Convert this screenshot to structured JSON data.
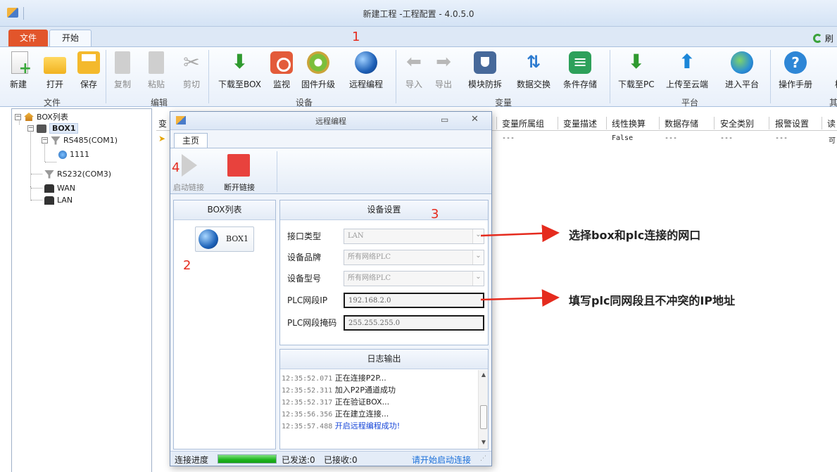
{
  "window": {
    "title": "新建工程 -工程配置 - 4.0.5.0"
  },
  "tabs": {
    "file": "文件",
    "start": "开始",
    "refresh": "刷"
  },
  "ribbon": {
    "file_group": {
      "label": "文件",
      "new": "新建",
      "open": "打开",
      "save": "保存"
    },
    "edit_group": {
      "label": "编辑",
      "copy": "复制",
      "paste": "粘贴",
      "cut": "剪切"
    },
    "device_group": {
      "label": "设备",
      "download_box": "下载至BOX",
      "monitor": "监视",
      "firmware": "固件升级",
      "remote": "远程编程"
    },
    "variable_group": {
      "label": "变量",
      "import": "导入",
      "export": "导出",
      "module_guard": "模块防拆",
      "data_exchange": "数据交换",
      "condition_store": "条件存储"
    },
    "platform_group": {
      "label": "平台",
      "download_pc": "下载至PC",
      "upload_cloud": "上传至云端",
      "enter_platform": "进入平台"
    },
    "help": {
      "manual": "操作手册",
      "truncated": "检",
      "group_truncated": "其"
    }
  },
  "tree": {
    "root": "BOX列表",
    "box": "BOX1",
    "rs485": "RS485(COM1)",
    "device": "1111",
    "rs232": "RS232(COM3)",
    "wan": "WAN",
    "lan": "LAN"
  },
  "grid": {
    "first_col": "变",
    "columns": [
      "变量所属组",
      "变量描述",
      "线性换算",
      "数据存储",
      "安全类别",
      "报警设置",
      "读"
    ],
    "row": [
      "---",
      "",
      "False",
      "---",
      "---",
      "---",
      "可"
    ]
  },
  "dialog": {
    "title": "远程编程",
    "tab": "主页",
    "start_link": "启动链接",
    "stop_link": "断开链接",
    "boxlist_title": "BOX列表",
    "box_item": "BOX1",
    "settings_title": "设备设置",
    "fields": {
      "interface_label": "接口类型",
      "interface_value": "LAN",
      "brand_label": "设备品牌",
      "brand_value": "所有网络PLC",
      "model_label": "设备型号",
      "model_value": "所有网络PLC",
      "ip_label": "PLC网段IP",
      "ip_value": "192.168.2.0",
      "mask_label": "PLC网段掩码",
      "mask_value": "255.255.255.0"
    },
    "log_title": "日志输出",
    "log": [
      {
        "time": "12:35:52.071",
        "msg": "正在连接P2P..."
      },
      {
        "time": "12:35:52.311",
        "msg": "加入P2P通道成功"
      },
      {
        "time": "12:35:52.317",
        "msg": "正在验证BOX..."
      },
      {
        "time": "12:35:56.356",
        "msg": "正在建立连接..."
      },
      {
        "time": "12:35:57.488",
        "msg": "开启远程编程成功!"
      }
    ],
    "status": {
      "progress_label": "连接进度",
      "progress": 1.0,
      "sent": "已发送:0",
      "received": "已接收:0",
      "hint": "请开始启动连接"
    }
  },
  "annotations": {
    "n1": "1",
    "n2": "2",
    "n3": "3",
    "n4": "4",
    "note_interface": "选择box和plc连接的网口",
    "note_ip": "填写plc同网段且不冲突的IP地址",
    "arrow_color": "#e52b1e"
  }
}
